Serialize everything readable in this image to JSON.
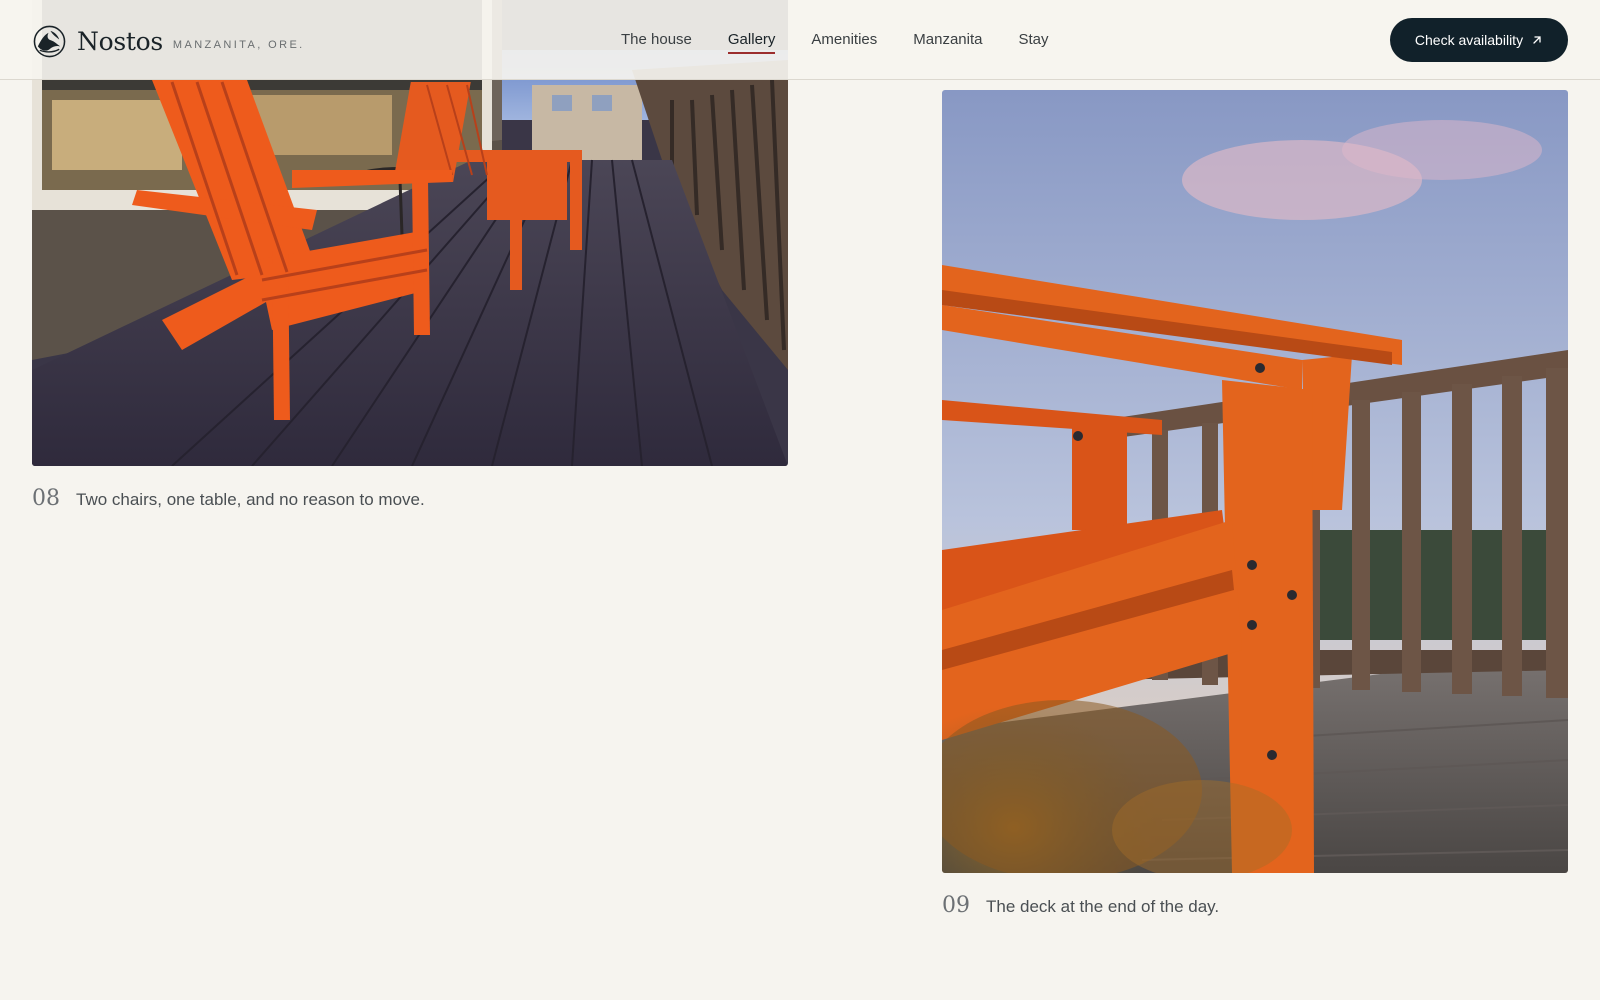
{
  "header": {
    "brand_name": "Nostos",
    "brand_location": "MANZANITA, ORE.",
    "logo_icon": "wave-mountain-logo-icon",
    "nav": [
      {
        "label": "The house",
        "active": false
      },
      {
        "label": "Gallery",
        "active": true
      },
      {
        "label": "Amenities",
        "active": false
      },
      {
        "label": "Manzanita",
        "active": false
      },
      {
        "label": "Stay",
        "active": false
      }
    ],
    "cta_label": "Check availability",
    "cta_icon": "arrow-up-right-icon"
  },
  "gallery": [
    {
      "number": "08",
      "caption": "Two chairs, one table, and no reason to move."
    },
    {
      "number": "09",
      "caption": "The deck at the end of the day."
    }
  ],
  "colors": {
    "background": "#f6f4ef",
    "cta_bg": "#11212a",
    "active_underline": "#9b2d2d",
    "chair_orange": "#e8561e"
  }
}
